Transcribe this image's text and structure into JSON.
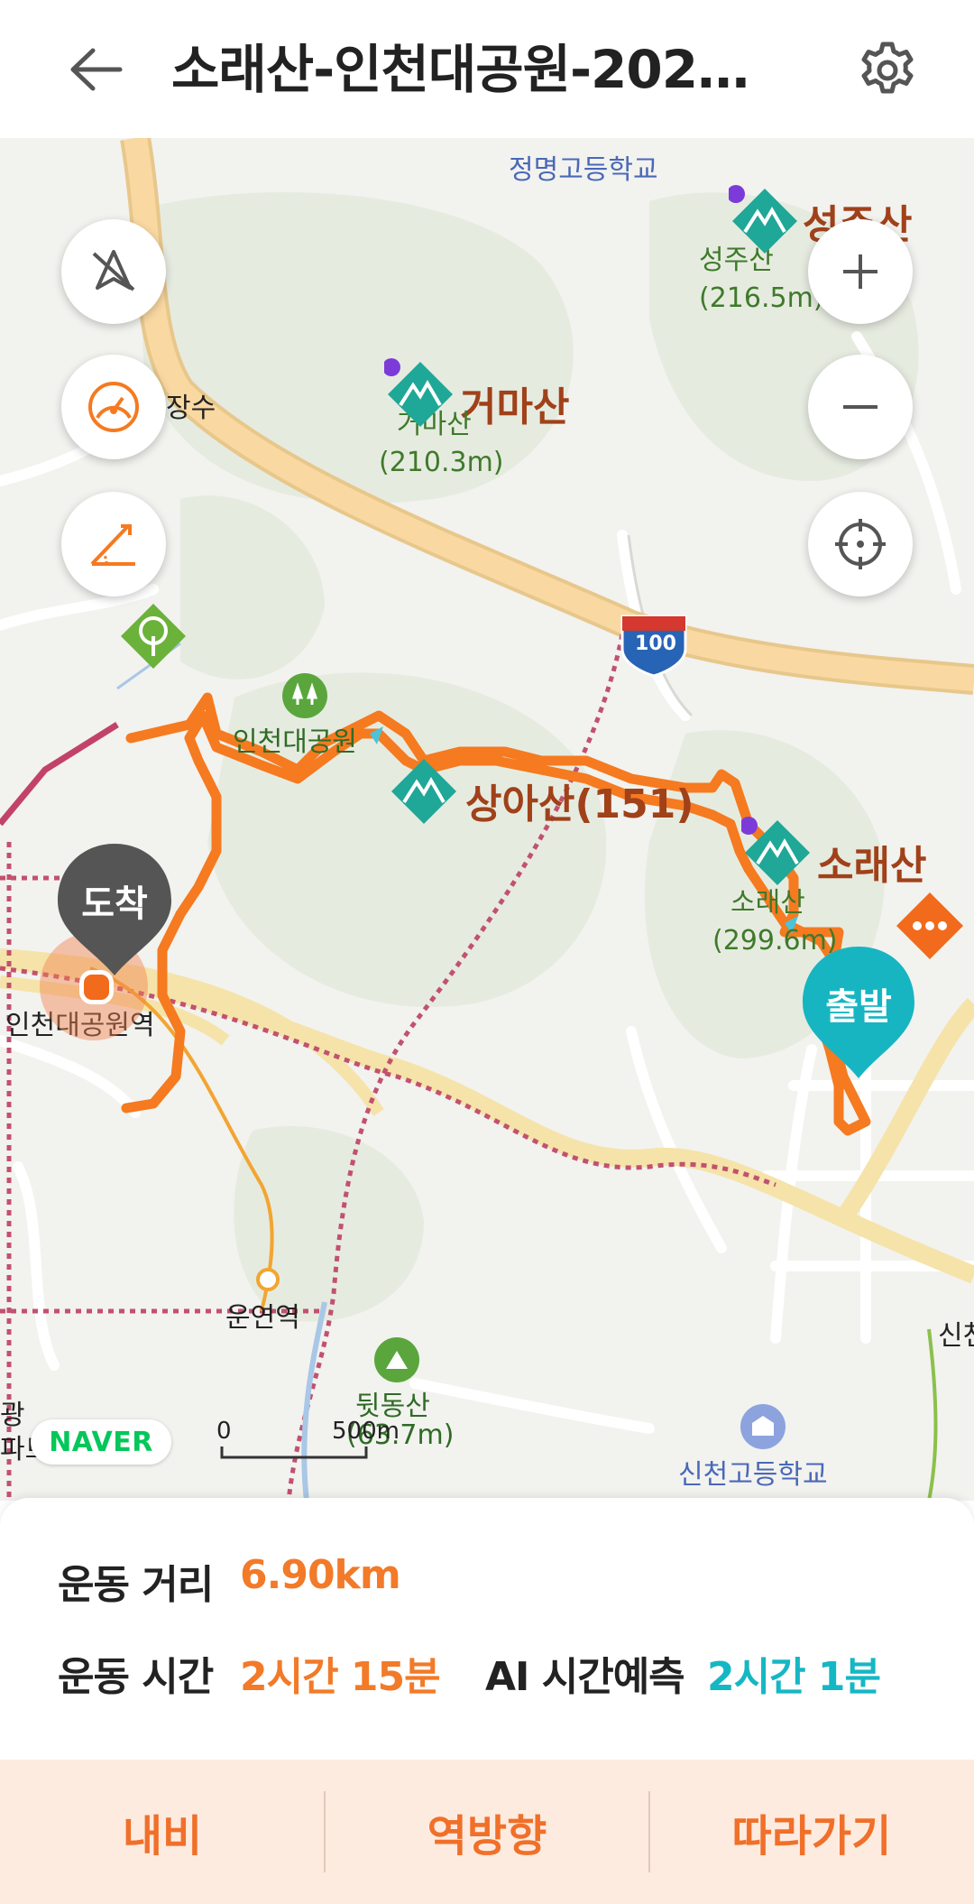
{
  "header": {
    "title": "소래산-인천대공원-202…",
    "back_icon": "arrow-left-icon",
    "settings_icon": "gear-icon"
  },
  "map": {
    "labels": {
      "school1": "정명고등학교",
      "seongjusan_big": "성주산",
      "seongjusan_sub1": "성주산",
      "seongjusan_sub2": "(216.5m)",
      "geomasan_big": "거마산",
      "geomasan_sub1": "거마산",
      "geomasan_sub2": "(210.3m)",
      "jangsu": "장수",
      "incheon_park": "인천대공원",
      "sangasan": "상아산(151)",
      "soraesan_big": "소래산",
      "soraesan_sub1": "소래산",
      "soraesan_sub2": "(299.6m)",
      "incheon_park_station": "인천대공원역",
      "unyeon_station": "운연역",
      "dwitdongsan_1": "뒷동산",
      "dwitdongsan_2": "(63.7m)",
      "sincheon_school": "신천고등학교",
      "gwang": "광",
      "apt": "파트",
      "sin": "신천",
      "highway": "100"
    },
    "markers": {
      "arrive": "도착",
      "depart": "출발"
    },
    "scale": {
      "zero": "0",
      "distance": "500m"
    },
    "naver_logo": "NAVER",
    "controls": {
      "compass_off_icon": "compass-off-icon",
      "speedometer_icon": "speedometer-icon",
      "slope_icon": "slope-angle-icon",
      "zoom_in_icon": "plus-icon",
      "zoom_out_icon": "minus-icon",
      "locate_icon": "crosshair-icon"
    },
    "colors": {
      "route": "#f57a20",
      "teal": "#17b5c2",
      "mountain": "#1fa797"
    }
  },
  "stats": {
    "distance_label": "운동 거리",
    "distance_value": "6.90km",
    "time_label": "운동 시간",
    "time_value": "2시간 15분",
    "ai_label": "AI 시간예측",
    "ai_value": "2시간 1분"
  },
  "actions": {
    "navi": "내비",
    "reverse": "역방향",
    "follow": "따라가기"
  }
}
